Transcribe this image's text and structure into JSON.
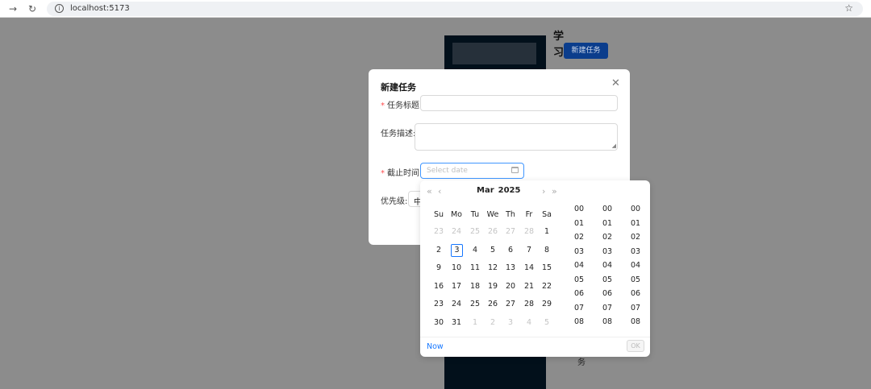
{
  "browser": {
    "url": "localhost:5173"
  },
  "background": {
    "title_chars": "学 习",
    "new_task_button": "新建任务",
    "footer_char": "务"
  },
  "modal": {
    "title": "新建任务",
    "fields": {
      "title_label": "任务标题:",
      "title_value": "",
      "desc_label": "任务描述:",
      "desc_value": "",
      "deadline_label": "截止时间:",
      "deadline_placeholder": "Select date",
      "priority_label": "优先级:",
      "priority_value": "中"
    }
  },
  "picker": {
    "month": "Mar",
    "year": "2025",
    "weekdays": [
      "Su",
      "Mo",
      "Tu",
      "We",
      "Th",
      "Fr",
      "Sa"
    ],
    "weeks": [
      [
        "23",
        "24",
        "25",
        "26",
        "27",
        "28",
        "1"
      ],
      [
        "2",
        "3",
        "4",
        "5",
        "6",
        "7",
        "8"
      ],
      [
        "9",
        "10",
        "11",
        "12",
        "13",
        "14",
        "15"
      ],
      [
        "16",
        "17",
        "18",
        "19",
        "20",
        "21",
        "22"
      ],
      [
        "23",
        "24",
        "25",
        "26",
        "27",
        "28",
        "29"
      ],
      [
        "30",
        "31",
        "1",
        "2",
        "3",
        "4",
        "5"
      ]
    ],
    "today": "3",
    "hours": [
      "00",
      "01",
      "02",
      "03",
      "04",
      "05",
      "06",
      "07",
      "08"
    ],
    "minutes": [
      "00",
      "01",
      "02",
      "03",
      "04",
      "05",
      "06",
      "07",
      "08"
    ],
    "seconds": [
      "00",
      "01",
      "02",
      "03",
      "04",
      "05",
      "06",
      "07",
      "08"
    ],
    "now_label": "Now",
    "ok_label": "OK"
  }
}
